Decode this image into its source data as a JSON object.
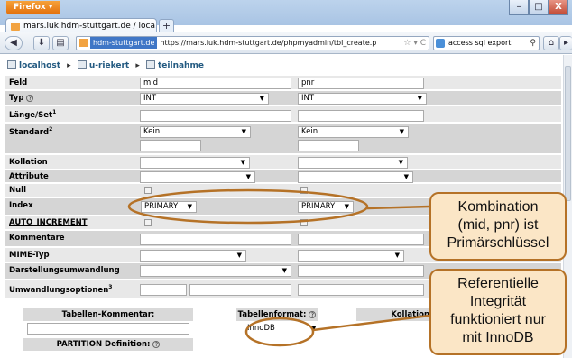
{
  "browser": {
    "menu_button": "Firefox",
    "tab_title": "mars.iuk.hdm-stuttgart.de / loca...",
    "new_tab": "+",
    "site_identity": "hdm-stuttgart.de",
    "url": "https://mars.iuk.hdm-stuttgart.de/phpmyadmin/tbl_create.p",
    "search_text": "access sql export",
    "window_buttons": {
      "minimize": "–",
      "maximize": "□",
      "close": "X"
    }
  },
  "breadcrumb": [
    {
      "label": "localhost",
      "icon": "server-icon"
    },
    {
      "label": "u-riekert",
      "icon": "database-icon"
    },
    {
      "label": "teilnahme",
      "icon": "table-icon"
    }
  ],
  "form": {
    "labels": {
      "feld": "Feld",
      "typ": "Typ",
      "laenge": "Länge/Set",
      "laenge_sup": "1",
      "standard": "Standard",
      "standard_sup": "2",
      "kollation": "Kollation",
      "attribute": "Attribute",
      "null": "Null",
      "index": "Index",
      "auto_increment": "AUTO_INCREMENT",
      "kommentare": "Kommentare",
      "mime": "MIME-Typ",
      "darstellung": "Darstellungsumwandlung",
      "umwandlung": "Umwandlungsoptionen",
      "umwandlung_sup": "3"
    },
    "col1": {
      "feld": "mid",
      "typ": "INT",
      "standard": "Kein",
      "index": "PRIMARY"
    },
    "col2": {
      "feld": "pnr",
      "typ": "INT",
      "standard": "Kein",
      "index": "PRIMARY"
    }
  },
  "lower": {
    "tabellen_kommentar": "Tabellen-Kommentar:",
    "tabellenformat": "Tabellenformat:",
    "kollation": "Kollation",
    "engine": "InnoDB",
    "partition": "PARTITION Definition:"
  },
  "annotations": {
    "callout1": [
      "Kombination",
      "(mid, pnr) ist",
      "Primärschlüssel"
    ],
    "callout2": [
      "Referentielle",
      "Integrität",
      "funktioniert nur",
      "mit InnoDB"
    ],
    "color": "#b57227",
    "fill": "#fbe6c6"
  }
}
